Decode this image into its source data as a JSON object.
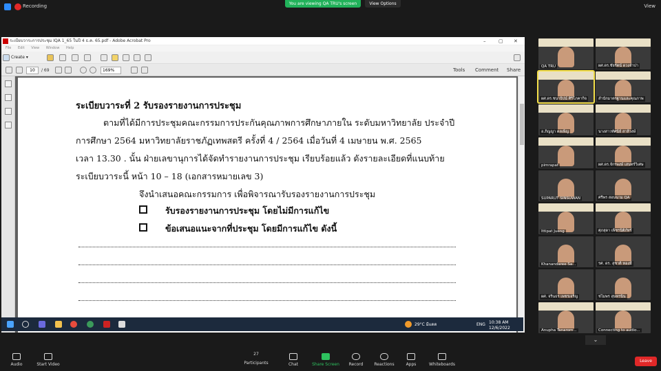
{
  "zoom": {
    "recording_label": "Recording",
    "share_banner": "You are viewing QA TRU's screen",
    "view_options_label": "View Options",
    "view_label": "View"
  },
  "acrobat": {
    "window_title": "ระเบียบวาระการประชุม IQA 1_65 ในปี 4 ธ.ค. 65.pdf - Adobe Acrobat Pro",
    "menu": [
      "File",
      "Edit",
      "View",
      "Window",
      "Help"
    ],
    "create_label": "Create",
    "page_current": "10",
    "page_total": "/ 69",
    "zoom_level": "169%",
    "right_links": [
      "Tools",
      "Comment",
      "Share"
    ]
  },
  "document": {
    "heading": "ระเบียบวาระที่ 2  รับรองรายงานการประชุม",
    "para_line1": "ตามที่ได้มีการประชุมคณะกรรมการประกันคุณภาพการศึกษาภายใน  ระดับมหาวิทยาลัย ประจำปี",
    "para_line2": "การศึกษา 2564 มหาวิทยาลัยราชภัฏเทพสตรี ครั้งที่ 4 / 2564 เมื่อวันที่ 4 เมษายน พ.ศ. 2565",
    "para_line3": "เวลา 13.30 . นั้น ฝ่ายเลขานุการได้จัดทำรายงานการประชุม เรียบร้อยแล้ว ดังรายละเอียดที่แนบท้าย",
    "para_line4": "ระเบียบวาระนี้ หน้า 10 – 18 (เอกสารหมายเลข 3)",
    "proposal": "จึงนำเสนอคณะกรรมการ เพื่อพิจารณารับรองรายงานการประชุม",
    "option1": "รับรองรายงานการประชุม โดยไม่มีการแก้ไข",
    "option2": "ข้อเสนอแนะจากที่ประชุม โดยมีการแก้ไข  ดังนี้"
  },
  "taskbar": {
    "weather": "29°C  มีแดด",
    "lang": "ENG",
    "time": "10:38 AM",
    "date": "12/6/2022"
  },
  "participants": [
    {
      "name": "QA TRU"
    },
    {
      "name": "ผศ.ดร.ชัยรัตน์ ดวงจำปา"
    },
    {
      "name": "ผศ.ดร.ชนาธิปน์ ศิริโภคากิจ"
    },
    {
      "name": "สำนักมาตรฐานและคุณภาพ"
    },
    {
      "name": "อ.ภิญญา ดลเพ็ญ"
    },
    {
      "name": "นางสาวทัศนีย์ สาลีวงษ์"
    },
    {
      "name": "pimrapat"
    },
    {
      "name": "ผศ.ดร.จักรพงษ์ เสนทร์วิเศษ"
    },
    {
      "name": "SUPARUT SINSUWAN"
    },
    {
      "name": "ศรีพร สอนนาม QA"
    },
    {
      "name": "Ittipat Jueng"
    },
    {
      "name": "ศุภสุดา เพ็ชรนิติภัทร์"
    },
    {
      "name": "Khanandaree Sa..."
    },
    {
      "name": "รศ. ดร. สุชาติ ทองมี"
    },
    {
      "name": "ผศ. จรินธร เพชรเจริญ"
    },
    {
      "name": "ชไมพร สุนทรนิน"
    },
    {
      "name": "Anupha Tanarom..."
    },
    {
      "name": "Connecting to audio..."
    }
  ],
  "bottombar": {
    "audio": "Audio",
    "video": "Start Video",
    "participants_count": "27",
    "participants": "Participants",
    "chat": "Chat",
    "share": "Share Screen",
    "record": "Record",
    "reactions": "Reactions",
    "apps": "Apps",
    "whiteboards": "Whiteboards",
    "leave": "Leave"
  },
  "colors": {
    "share_green": "#21b25a",
    "leave_red": "#e02828",
    "active_speaker": "#f5e04a"
  }
}
